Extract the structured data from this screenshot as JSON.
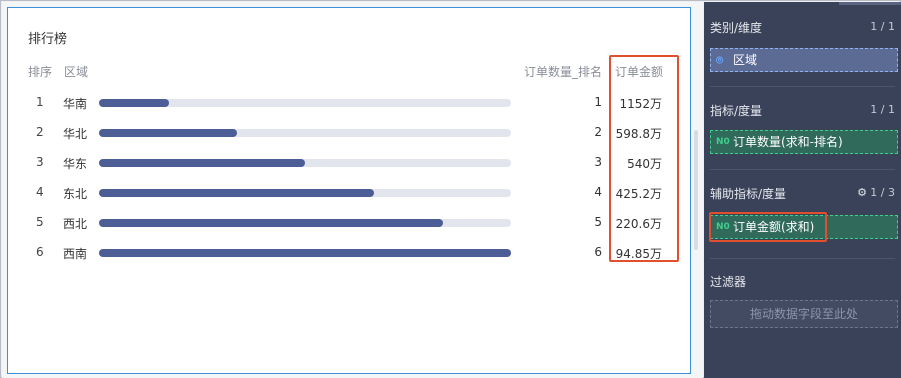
{
  "chart": {
    "title": "排行榜",
    "columns": {
      "rank": "排序",
      "region": "区域",
      "count_rank": "订单数量_排名",
      "amount": "订单金额"
    },
    "rows": [
      {
        "rank": "1",
        "region": "华南",
        "bar_fraction": 0.17,
        "count_rank": "1",
        "amount": "1152万"
      },
      {
        "rank": "2",
        "region": "华北",
        "bar_fraction": 0.335,
        "count_rank": "2",
        "amount": "598.8万"
      },
      {
        "rank": "3",
        "region": "华东",
        "bar_fraction": 0.5,
        "count_rank": "3",
        "amount": "540万"
      },
      {
        "rank": "4",
        "region": "东北",
        "bar_fraction": 0.668,
        "count_rank": "4",
        "amount": "425.2万"
      },
      {
        "rank": "5",
        "region": "西北",
        "bar_fraction": 0.835,
        "count_rank": "5",
        "amount": "220.6万"
      },
      {
        "rank": "6",
        "region": "西南",
        "bar_fraction": 1.0,
        "count_rank": "6",
        "amount": "94.85万"
      }
    ]
  },
  "config": {
    "dimension": {
      "title": "类别/维度",
      "count": "1 / 1",
      "field": "区域",
      "icon": "location-pin-icon"
    },
    "measure": {
      "title": "指标/度量",
      "count": "1 / 1",
      "field": "订单数量(求和-排名)",
      "icon_text": "N0"
    },
    "aux_measure": {
      "title": "辅助指标/度量",
      "count": "1 / 3",
      "field": "订单金额(求和)",
      "icon_text": "N0",
      "gear_icon": "gear-icon"
    },
    "filter": {
      "title": "过滤器",
      "drop_placeholder": "拖动数据字段至此处"
    }
  },
  "colors": {
    "bar_fill": "#4d5d95",
    "bar_track": "#e2e5ec",
    "highlight": "#e0502f",
    "panel_bg": "#3a4259",
    "measure_green": "#3fce8c",
    "dimension_blue": "#5b6b94"
  }
}
